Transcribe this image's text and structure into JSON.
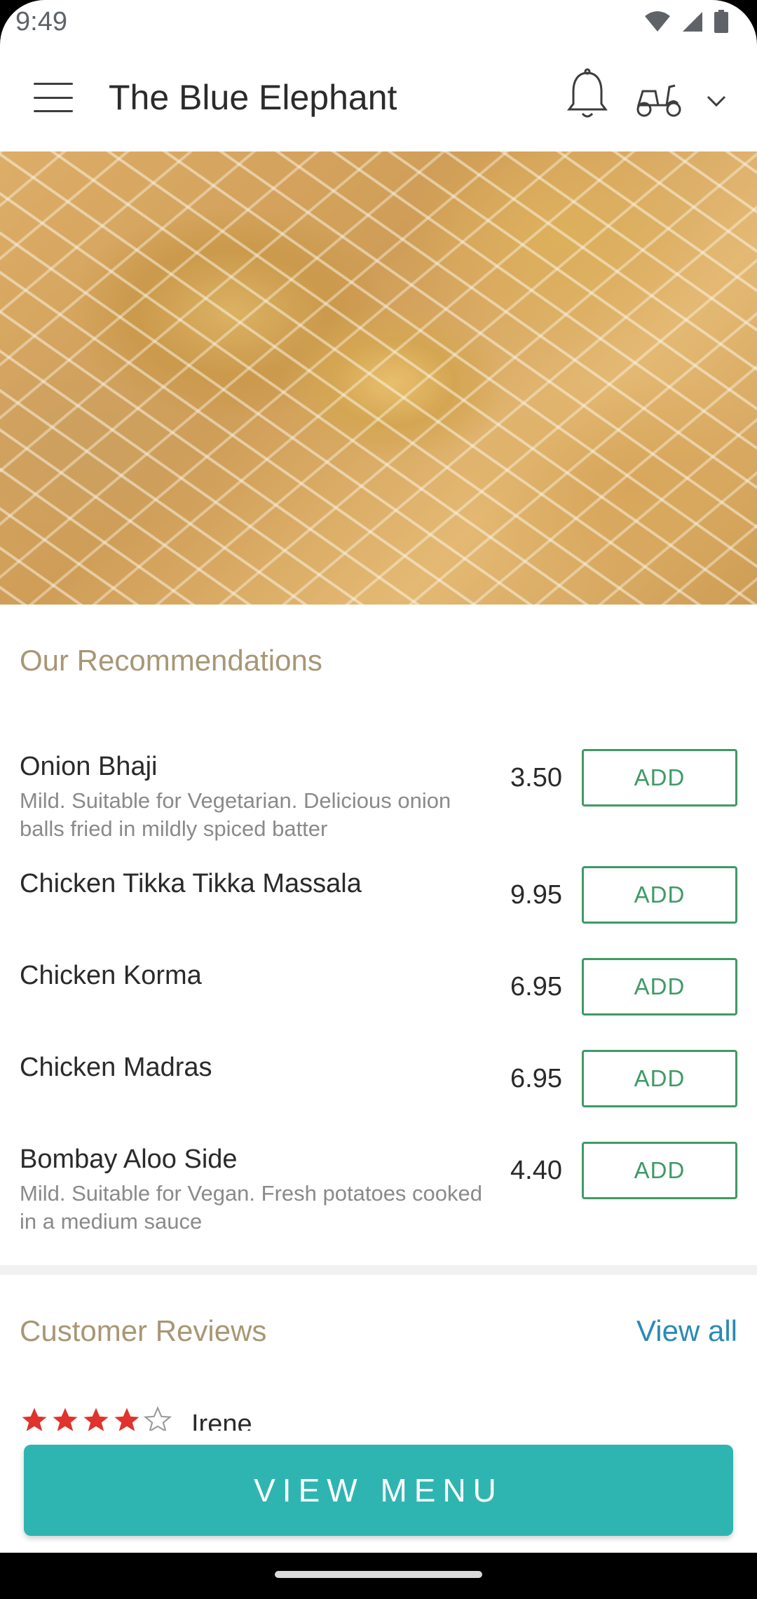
{
  "status_bar": {
    "time": "9:49"
  },
  "header": {
    "title": "The Blue Elephant",
    "icons": [
      "menu-icon",
      "bell-icon",
      "scooter-icon",
      "chevron-down-icon"
    ]
  },
  "recommendations": {
    "title": "Our Recommendations",
    "items": [
      {
        "name": "Onion Bhaji",
        "description": "Mild. Suitable for Vegetarian. Delicious onion balls fried in mildly spiced batter",
        "price": "3.50",
        "button": "ADD"
      },
      {
        "name": "Chicken Tikka Tikka Massala",
        "description": "",
        "price": "9.95",
        "button": "ADD"
      },
      {
        "name": "Chicken Korma",
        "description": "",
        "price": "6.95",
        "button": "ADD"
      },
      {
        "name": "Chicken Madras",
        "description": "",
        "price": "6.95",
        "button": "ADD"
      },
      {
        "name": "Bombay Aloo Side",
        "description": "Mild. Suitable for Vegan. Fresh potatoes cooked in a medium sauce",
        "price": "4.40",
        "button": "ADD"
      }
    ]
  },
  "reviews": {
    "title": "Customer Reviews",
    "view_all": "View all",
    "first_review": {
      "name": "Irene",
      "rating": 4,
      "max_rating": 5
    }
  },
  "cta": {
    "label": "VIEW MENU"
  },
  "colors": {
    "accent_green": "#3f9a67",
    "cta_teal": "#2fb5b1",
    "section_title": "#a89775",
    "link_blue": "#2a8ab4",
    "star_red": "#e0332d"
  }
}
